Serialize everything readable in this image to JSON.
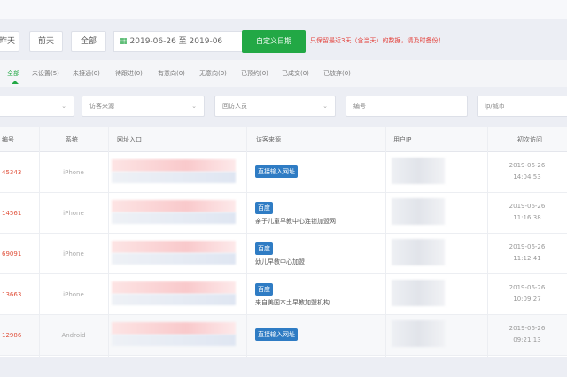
{
  "toolbar": {
    "yesterday": "昨天",
    "day_before": "前天",
    "all": "全部",
    "date_range": "2019-06-26 至 2019-06",
    "custom_date": "自定义日期",
    "note": "只保留最近3天（含当天）的数据，请及时备份！"
  },
  "tabs": [
    {
      "label": "全部"
    },
    {
      "label": "未设置(5)"
    },
    {
      "label": "未接通(0)"
    },
    {
      "label": "待跟进(0)"
    },
    {
      "label": "有意向(0)"
    },
    {
      "label": "无意向(0)"
    },
    {
      "label": "已预约(0)"
    },
    {
      "label": "已成交(0)"
    },
    {
      "label": "已放弃(0)"
    }
  ],
  "filters": {
    "source": "访客来源",
    "visitor": "回访人员",
    "number": "编号",
    "ip_city": "ip/城市"
  },
  "columns": [
    "编号",
    "系统",
    "网址入口",
    "访客来源",
    "用户IP",
    "初次访问"
  ],
  "rows": [
    {
      "id": "45343",
      "system": "iPhone",
      "source_tag": "直接输入网址",
      "source_text": "",
      "date": "2019-06-26",
      "time": "14:04:53"
    },
    {
      "id": "14561",
      "system": "iPhone",
      "source_tag": "百度",
      "source_text": "亲子儿童早教中心连锁加盟网",
      "date": "2019-06-26",
      "time": "11:16:38"
    },
    {
      "id": "69091",
      "system": "iPhone",
      "source_tag": "百度",
      "source_text": "幼儿早教中心加盟",
      "date": "2019-06-26",
      "time": "11:12:41"
    },
    {
      "id": "13663",
      "system": "iPhone",
      "source_tag": "百度",
      "source_text": "来自美国本土早教加盟机构",
      "date": "2019-06-26",
      "time": "10:09:27"
    },
    {
      "id": "12986",
      "system": "Android",
      "source_tag": "直接输入网址",
      "source_text": "",
      "date": "2019-06-26",
      "time": "09:21:13"
    }
  ]
}
